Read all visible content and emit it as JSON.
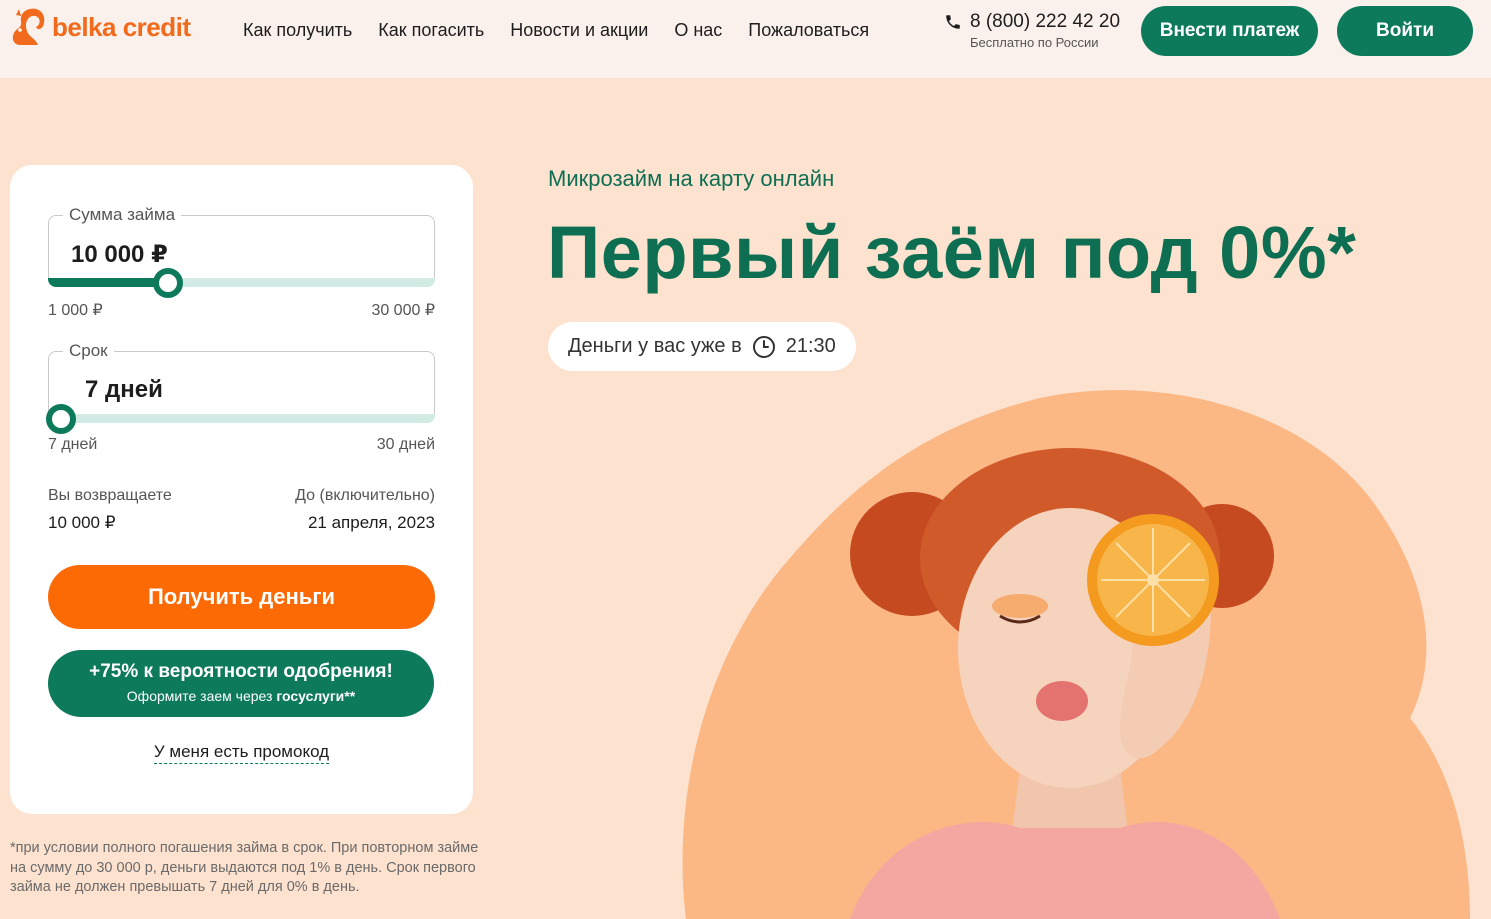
{
  "brand": {
    "name": "belka credit",
    "color": "#f26a1b",
    "accent": "#0e7a5c",
    "cta_color": "#fb6a05"
  },
  "nav": {
    "items": [
      {
        "label": "Как получить"
      },
      {
        "label": "Как погасить"
      },
      {
        "label": "Новости и акции"
      },
      {
        "label": "О нас"
      },
      {
        "label": "Пожаловаться"
      }
    ]
  },
  "contact": {
    "phone": "8 (800) 222 42 20",
    "note": "Бесплатно по России",
    "icon": "phone-icon"
  },
  "header_buttons": {
    "pay": "Внести платеж",
    "login": "Войти"
  },
  "calculator": {
    "amount": {
      "label": "Сумма займа",
      "value": "10 000 ₽",
      "min": "1 000 ₽",
      "max": "30 000 ₽",
      "position": 0.31
    },
    "term": {
      "label": "Срок",
      "value": "7 дней",
      "min": "7 дней",
      "max": "30 дней",
      "position": 0.0
    },
    "repay_label": "Вы возвращаете",
    "repay_value": "10 000 ₽",
    "until_label": "До (включительно)",
    "until_value": "21 апреля, 2023",
    "submit": "Получить деньги",
    "gos_title": "+75% к вероятности одобрения!",
    "gos_sub": "Оформите заем через",
    "gos_brand": "госуслуги",
    "gos_mark": "**",
    "promo": "У меня есть промокод"
  },
  "footnote": "*при условии полного погашения займа в срок. При повторном займе на сумму до 30 000 р, деньги выдаются под 1% в день. Срок первого займа не должен превышать 7 дней для 0% в день.",
  "hero": {
    "subtitle": "Микрозайм на карту онлайн",
    "headline": "Первый заём под 0%*",
    "pill_text": "Деньги у вас уже в",
    "pill_time": "21:30",
    "pill_icon": "clock-icon"
  }
}
